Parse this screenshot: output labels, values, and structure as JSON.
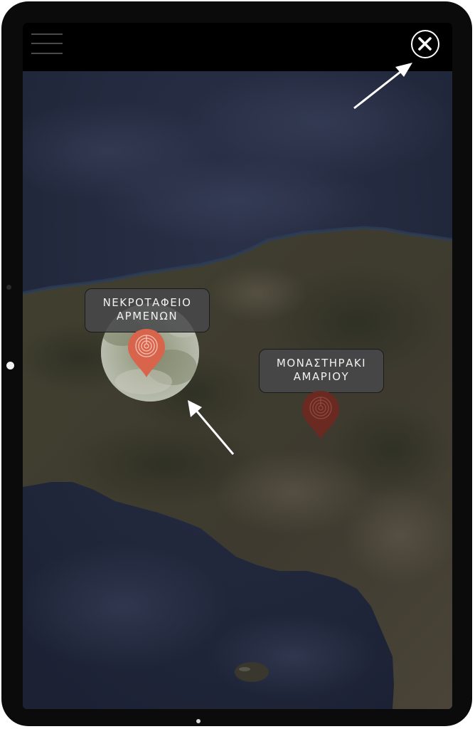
{
  "map": {
    "type": "satellite",
    "markers": [
      {
        "id": "armenon",
        "label_line1": "ΝΕΚΡΟΤΑΦΕΙΟ",
        "label_line2": "ΑΡΜΕΝΩΝ",
        "state": "selected",
        "color": "#d9644c"
      },
      {
        "id": "amariou",
        "label_line1": "ΜΟΝΑΣΤΗΡΑΚΙ",
        "label_line2": "ΑΜΑΡΙΟΥ",
        "state": "default",
        "color": "#6a2a22"
      }
    ]
  },
  "toolbar": {
    "menu_icon": "hamburger-menu-icon",
    "close_icon": "close-icon"
  },
  "pin_icon": "labyrinth-icon",
  "colors": {
    "sea": "#232a40",
    "land": "#3e3a2e",
    "topbar": "#000000",
    "pin_active": "#d9644c",
    "pin_inactive": "#6a2a22"
  }
}
